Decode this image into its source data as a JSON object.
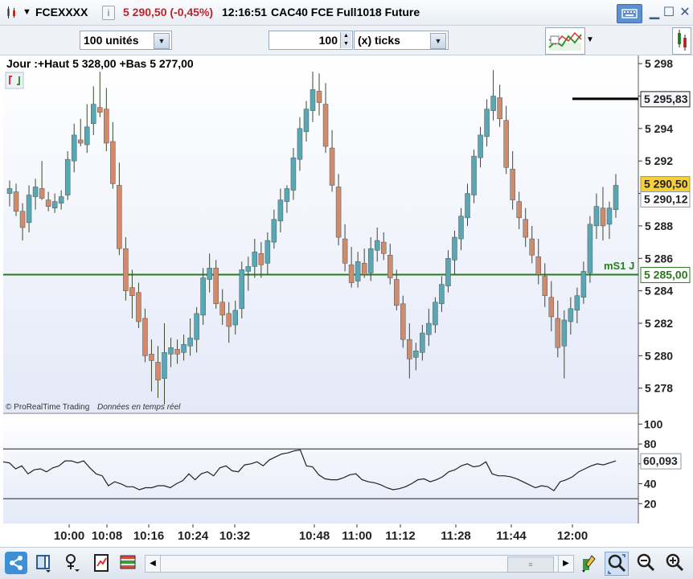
{
  "header": {
    "symbol": "FCEXXXX",
    "info_icon": "info-icon",
    "last_change": "5 290,50 (-0,45%)",
    "time": "12:16:51",
    "instrument": "CAC40 FCE Full1018 Future"
  },
  "toolbar": {
    "units_value": "100 unités",
    "ticks_value": "100",
    "ticks_mode": "(x) ticks"
  },
  "chart_text": {
    "range_label": "Jour :+Haut 5 328,00 +Bas 5 277,00",
    "watermark_brand": "© ProRealTime Trading",
    "watermark_feed": "Données en temps réel",
    "level_label": "mS1 J",
    "level_value": "5 285,00",
    "marker_value": "5 295,83",
    "price_last": "5 290,50",
    "price_bid": "5 290,12",
    "osc_value": "60,093"
  },
  "colors": {
    "up": "#5aa7b4",
    "down": "#d08b6c",
    "level": "#2b7a1d",
    "last_bg": "#f5cf3c"
  },
  "chart_data": [
    {
      "type": "candlestick",
      "x_ticks": [
        "10:00",
        "10:08",
        "10:16",
        "10:24",
        "10:32",
        "10:48",
        "11:00",
        "11:12",
        "11:28",
        "11:44",
        "12:00"
      ],
      "y_ticks": [
        "5 298",
        "5 296",
        "5 294",
        "5 292",
        "5 290",
        "5 288",
        "5 286",
        "5 284",
        "5 282",
        "5 280",
        "5 278"
      ],
      "ylim": [
        5276.5,
        5298.5
      ],
      "horizontal_lines": [
        5285.0,
        5295.83
      ],
      "ohlc": [
        [
          5290.0,
          5290.8,
          5289.2,
          5290.3
        ],
        [
          5290.1,
          5290.6,
          5288.6,
          5288.9
        ],
        [
          5288.9,
          5289.4,
          5287.1,
          5287.9
        ],
        [
          5288.2,
          5290.5,
          5287.6,
          5289.9
        ],
        [
          5289.8,
          5290.9,
          5289.0,
          5290.4
        ],
        [
          5290.3,
          5292.0,
          5289.6,
          5289.7
        ],
        [
          5289.6,
          5290.1,
          5288.9,
          5289.2
        ],
        [
          5289.1,
          5290.0,
          5288.8,
          5289.5
        ],
        [
          5289.4,
          5290.2,
          5289.0,
          5289.8
        ],
        [
          5289.9,
          5292.6,
          5289.6,
          5292.1
        ],
        [
          5292.0,
          5294.3,
          5291.3,
          5293.6
        ],
        [
          5293.3,
          5294.6,
          5292.9,
          5293.1
        ],
        [
          5293.0,
          5295.5,
          5292.5,
          5294.1
        ],
        [
          5294.3,
          5296.6,
          5293.6,
          5295.5
        ],
        [
          5295.3,
          5297.5,
          5294.7,
          5295.0
        ],
        [
          5295.2,
          5296.5,
          5292.6,
          5293.1
        ],
        [
          5293.2,
          5294.4,
          5290.3,
          5290.6
        ],
        [
          5290.5,
          5291.9,
          5286.2,
          5286.6
        ],
        [
          5286.6,
          5287.3,
          5283.4,
          5284.0
        ],
        [
          5284.2,
          5285.3,
          5282.3,
          5283.7
        ],
        [
          5283.9,
          5284.5,
          5281.7,
          5282.1
        ],
        [
          5282.3,
          5282.9,
          5279.6,
          5280.0
        ],
        [
          5280.1,
          5281.0,
          5277.8,
          5279.7
        ],
        [
          5279.6,
          5280.6,
          5277.4,
          5278.5
        ],
        [
          5278.6,
          5282.0,
          5277.0,
          5280.2
        ],
        [
          5280.1,
          5281.1,
          5279.3,
          5280.5
        ],
        [
          5280.4,
          5281.0,
          5279.5,
          5280.1
        ],
        [
          5280.2,
          5281.3,
          5279.7,
          5280.7
        ],
        [
          5280.6,
          5282.3,
          5280.0,
          5281.1
        ],
        [
          5281.0,
          5283.0,
          5280.2,
          5282.6
        ],
        [
          5282.5,
          5285.4,
          5281.9,
          5284.8
        ],
        [
          5284.7,
          5286.3,
          5283.9,
          5285.4
        ],
        [
          5285.4,
          5285.9,
          5282.9,
          5283.2
        ],
        [
          5283.3,
          5284.1,
          5281.9,
          5282.5
        ],
        [
          5282.6,
          5283.3,
          5280.8,
          5281.8
        ],
        [
          5281.9,
          5283.4,
          5281.3,
          5282.8
        ],
        [
          5282.9,
          5285.8,
          5282.3,
          5285.3
        ],
        [
          5285.2,
          5286.1,
          5284.0,
          5285.5
        ],
        [
          5285.5,
          5287.2,
          5284.8,
          5286.4
        ],
        [
          5286.3,
          5287.0,
          5284.8,
          5285.6
        ],
        [
          5285.7,
          5287.6,
          5285.0,
          5287.1
        ],
        [
          5287.0,
          5289.0,
          5286.6,
          5288.4
        ],
        [
          5288.3,
          5290.3,
          5287.6,
          5289.6
        ],
        [
          5289.5,
          5290.5,
          5288.8,
          5290.3
        ],
        [
          5290.2,
          5292.8,
          5289.6,
          5292.2
        ],
        [
          5292.1,
          5294.7,
          5291.4,
          5294.0
        ],
        [
          5293.8,
          5295.7,
          5293.2,
          5295.2
        ],
        [
          5295.1,
          5297.5,
          5294.4,
          5296.4
        ],
        [
          5296.3,
          5297.4,
          5294.8,
          5295.6
        ],
        [
          5295.5,
          5296.8,
          5292.5,
          5292.9
        ],
        [
          5292.8,
          5293.9,
          5290.1,
          5290.5
        ],
        [
          5290.4,
          5291.2,
          5286.8,
          5287.3
        ],
        [
          5287.2,
          5288.1,
          5285.2,
          5285.7
        ],
        [
          5285.6,
          5286.7,
          5284.2,
          5284.5
        ],
        [
          5284.6,
          5286.4,
          5284.2,
          5285.8
        ],
        [
          5285.7,
          5286.6,
          5284.8,
          5285.0
        ],
        [
          5285.1,
          5287.3,
          5284.6,
          5286.6
        ],
        [
          5286.5,
          5287.9,
          5285.8,
          5287.1
        ],
        [
          5287.0,
          5287.6,
          5285.9,
          5286.3
        ],
        [
          5286.2,
          5286.9,
          5284.4,
          5284.8
        ],
        [
          5284.7,
          5285.3,
          5282.8,
          5283.1
        ],
        [
          5283.2,
          5283.7,
          5280.5,
          5281.0
        ],
        [
          5281.0,
          5282.0,
          5278.6,
          5279.8
        ],
        [
          5279.9,
          5280.8,
          5279.1,
          5280.3
        ],
        [
          5280.2,
          5281.9,
          5279.7,
          5281.4
        ],
        [
          5281.3,
          5282.9,
          5280.6,
          5282.0
        ],
        [
          5281.9,
          5283.6,
          5281.4,
          5283.3
        ],
        [
          5283.2,
          5284.9,
          5282.7,
          5284.4
        ],
        [
          5284.3,
          5286.5,
          5283.9,
          5286.0
        ],
        [
          5285.9,
          5287.7,
          5285.0,
          5287.3
        ],
        [
          5287.2,
          5289.1,
          5286.5,
          5288.6
        ],
        [
          5288.5,
          5290.6,
          5288.0,
          5290.0
        ],
        [
          5289.9,
          5292.7,
          5289.4,
          5292.3
        ],
        [
          5292.2,
          5294.1,
          5291.6,
          5293.6
        ],
        [
          5293.5,
          5295.8,
          5292.9,
          5295.2
        ],
        [
          5295.1,
          5297.6,
          5294.5,
          5296.0
        ],
        [
          5295.9,
          5296.7,
          5294.1,
          5294.6
        ],
        [
          5294.5,
          5295.4,
          5291.2,
          5291.6
        ],
        [
          5291.5,
          5292.6,
          5289.0,
          5289.6
        ],
        [
          5289.5,
          5290.1,
          5287.8,
          5288.5
        ],
        [
          5288.4,
          5289.1,
          5286.7,
          5287.3
        ],
        [
          5287.2,
          5288.0,
          5285.7,
          5286.2
        ],
        [
          5286.1,
          5287.2,
          5284.4,
          5285.0
        ],
        [
          5284.9,
          5285.7,
          5283.0,
          5283.7
        ],
        [
          5283.6,
          5284.6,
          5281.5,
          5282.4
        ],
        [
          5282.3,
          5283.4,
          5279.9,
          5280.5
        ],
        [
          5280.6,
          5282.8,
          5278.6,
          5282.2
        ],
        [
          5282.1,
          5283.6,
          5281.3,
          5282.9
        ],
        [
          5282.8,
          5284.2,
          5282.0,
          5283.7
        ],
        [
          5283.6,
          5285.8,
          5283.2,
          5285.2
        ],
        [
          5285.1,
          5288.6,
          5284.5,
          5288.1
        ],
        [
          5288.0,
          5290.0,
          5287.2,
          5289.2
        ],
        [
          5289.1,
          5290.4,
          5287.1,
          5288.0
        ],
        [
          5288.1,
          5289.5,
          5287.2,
          5289.1
        ],
        [
          5289.0,
          5291.2,
          5288.5,
          5290.5
        ]
      ]
    },
    {
      "type": "line",
      "y_ticks": [
        100,
        80,
        60,
        40,
        20
      ],
      "ylim": [
        0,
        110
      ],
      "horizontal_lines": [
        75,
        25
      ],
      "values": [
        62,
        61,
        55,
        58,
        50,
        54,
        55,
        52,
        56,
        58,
        63,
        63,
        61,
        63,
        56,
        50,
        48,
        38,
        42,
        40,
        37,
        37,
        34,
        36,
        36,
        38,
        38,
        36,
        40,
        43,
        50,
        44,
        50,
        52,
        48,
        56,
        58,
        53,
        52,
        59,
        60,
        62,
        58,
        64,
        67,
        70,
        71,
        73,
        74,
        58,
        57,
        49,
        45,
        44,
        44,
        46,
        49,
        50,
        44,
        42,
        41,
        39,
        36,
        34,
        35,
        37,
        40,
        44,
        45,
        42,
        44,
        47,
        52,
        54,
        58,
        60,
        57,
        58,
        62,
        50,
        48,
        48,
        47,
        45,
        42,
        39,
        36,
        38,
        37,
        33,
        42,
        44,
        47,
        52,
        55,
        58,
        60,
        59,
        61,
        63
      ]
    }
  ]
}
